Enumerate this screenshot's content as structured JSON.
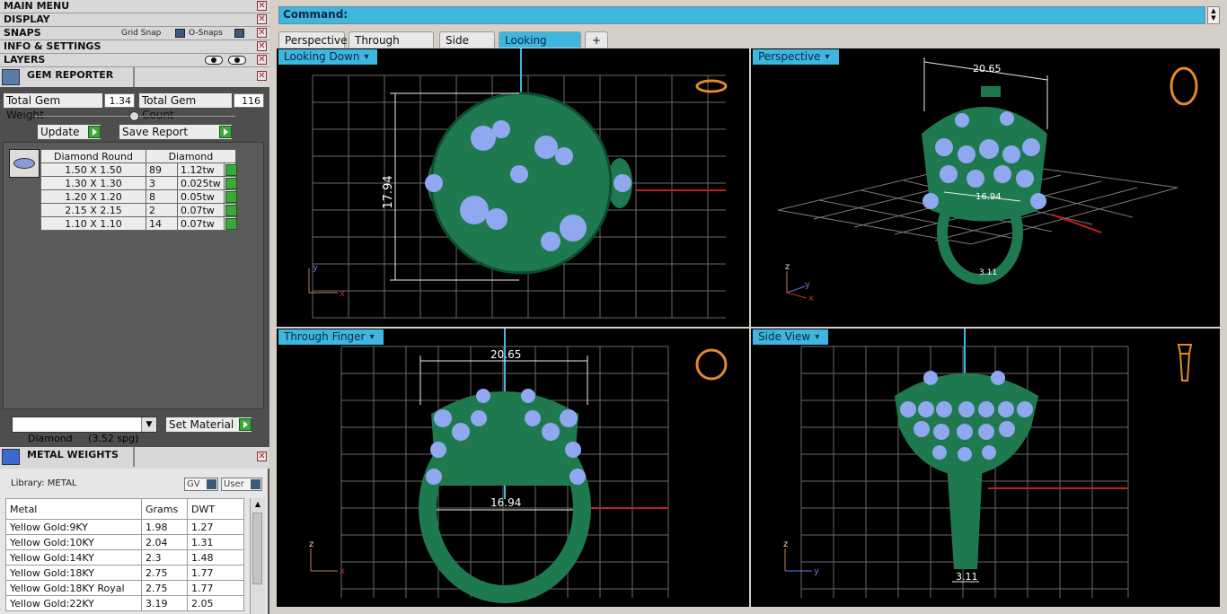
{
  "menus": [
    {
      "label": "MAIN MENU"
    },
    {
      "label": "DISPLAY"
    },
    {
      "label": "SNAPS"
    },
    {
      "label": "INFO & SETTINGS"
    },
    {
      "label": "LAYERS"
    }
  ],
  "snaps": {
    "grid_snap": "Grid Snap",
    "o_snaps": "O-Snaps"
  },
  "close_glyph": "✕",
  "gem_reporter": {
    "title": "GEM REPORTER",
    "total_weight_label": "Total Gem Weight",
    "total_weight": "1.34",
    "total_count_label": "Total Gem Count",
    "total_count": "116",
    "update_label": "Update",
    "save_label": "Save Report",
    "col_shape": "Diamond Round",
    "col_material": "Diamond",
    "rows": [
      {
        "size": "1.50 X 1.50",
        "count": "89",
        "tw": "1.12tw"
      },
      {
        "size": "1.30 X 1.30",
        "count": "3",
        "tw": "0.025tw"
      },
      {
        "size": "1.20 X 1.20",
        "count": "8",
        "tw": "0.05tw"
      },
      {
        "size": "2.15 X 2.15",
        "count": "2",
        "tw": "0.07tw"
      },
      {
        "size": "1.10 X 1.10",
        "count": "14",
        "tw": "0.07tw"
      }
    ],
    "material_select": "Diamond     (3.52 spg)",
    "set_material_label": "Set Material"
  },
  "metal_weights": {
    "title": "METAL WEIGHTS",
    "library_label": "Library: METAL",
    "gv_label": "GV",
    "user_label": "User",
    "headers": [
      "Metal",
      "Grams",
      "DWT"
    ],
    "rows": [
      [
        "Yellow Gold:9KY",
        "1.98",
        "1.27"
      ],
      [
        "Yellow Gold:10KY",
        "2.04",
        "1.31"
      ],
      [
        "Yellow Gold:14KY",
        "2.3",
        "1.48"
      ],
      [
        "Yellow Gold:18KY",
        "2.75",
        "1.77"
      ],
      [
        "Yellow Gold:18KY Royal",
        "2.75",
        "1.77"
      ],
      [
        "Yellow Gold:22KY",
        "3.19",
        "2.05"
      ]
    ]
  },
  "command_label": "Command:",
  "tabs": [
    {
      "label": "Perspective",
      "active": false
    },
    {
      "label": "Through Finger",
      "active": false
    },
    {
      "label": "Side View",
      "active": false
    },
    {
      "label": "Looking Down",
      "active": true
    },
    {
      "label": "+",
      "active": false
    }
  ],
  "viewports": {
    "top_left": {
      "label": "Looking Down",
      "dim": "17.94"
    },
    "top_right": {
      "label": "Perspective",
      "dim1": "20.65",
      "dim2": "16.94",
      "dim3": "3.11"
    },
    "bottom_left": {
      "label": "Through Finger",
      "dim1": "20.65",
      "dim2": "16.94"
    },
    "bottom_right": {
      "label": "Side View",
      "dim": "3.11"
    }
  },
  "axes": {
    "x": "x",
    "y": "y",
    "z": "z"
  },
  "colors": {
    "metal": "#1e7a4e",
    "gem": "#8fa8f0",
    "grid": "#6a6a6a",
    "accent": "#3eb6e0",
    "dimension": "#ffffff"
  }
}
